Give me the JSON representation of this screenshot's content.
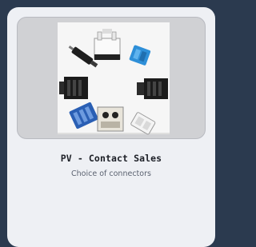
{
  "product_card": {
    "title": "PV - Contact Sales",
    "subtitle": "Choice of connectors",
    "image_alt": "Assortment of PV connectors"
  }
}
